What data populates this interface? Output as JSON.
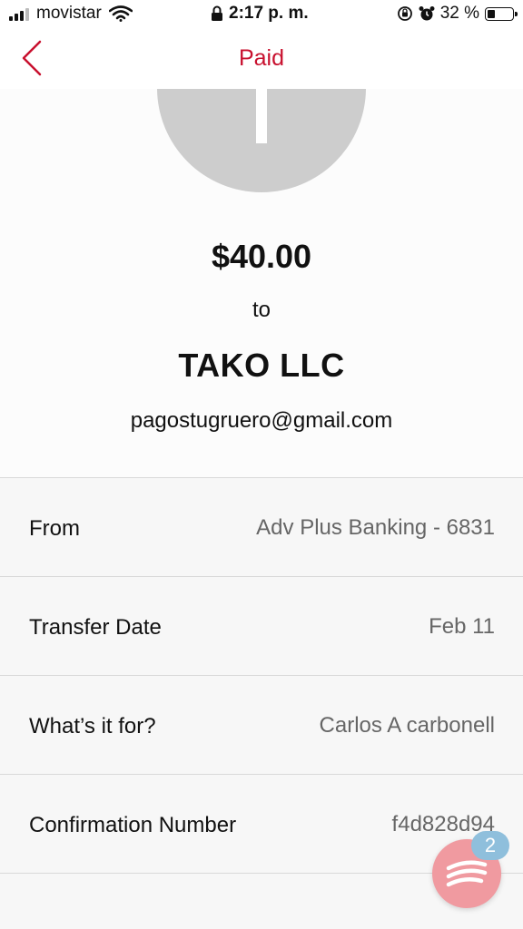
{
  "status_bar": {
    "carrier": "movistar",
    "time": "2:17 p. m.",
    "battery": "32 %",
    "battery_level": 0.32
  },
  "nav": {
    "title": "Paid",
    "accent_color": "#c8102e"
  },
  "payment": {
    "amount": "$40.00",
    "to_label": "to",
    "payee_name": "TAKO LLC",
    "payee_email": "pagostugruero@gmail.com"
  },
  "details": [
    {
      "label": "From",
      "value": "Adv Plus Banking - 6831"
    },
    {
      "label": "Transfer Date",
      "value": "Feb 11"
    },
    {
      "label": "What’s it for?",
      "value": "Carlos A carbonell"
    },
    {
      "label": "Confirmation Number",
      "value": "f4d828d94"
    }
  ],
  "chat": {
    "badge_count": "2"
  },
  "icons": [
    "signal-icon",
    "wifi-icon",
    "lock-icon",
    "orientation-lock-icon",
    "alarm-icon",
    "battery-icon",
    "back-chevron-icon",
    "chat-icon"
  ]
}
